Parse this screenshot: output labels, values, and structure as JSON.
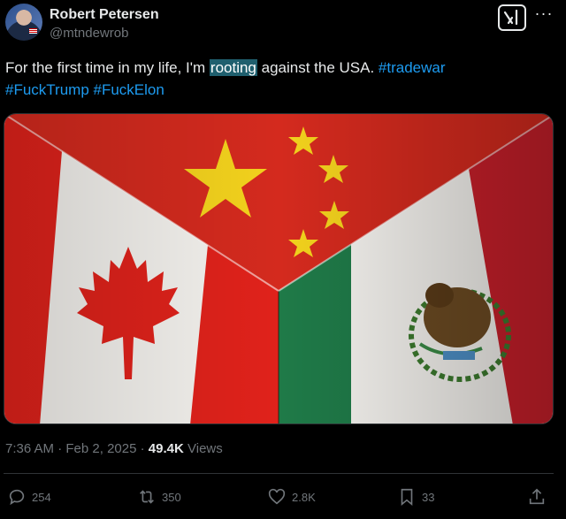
{
  "author": {
    "name": "Robert Petersen",
    "handle": "@mtndewrob"
  },
  "tweet": {
    "text_before": "For the first time in my life, I'm ",
    "highlighted_word": "rooting",
    "text_after": " against the USA. ",
    "hashtags": [
      "#tradewar",
      "#FuckTrump",
      "#FuckElon"
    ]
  },
  "media": {
    "description_icon": "flags-image",
    "colors": {
      "china_red": "#d42a1e",
      "china_star": "#f3d21d",
      "canada_red": "#e0221b",
      "mexico_green": "#1f7a48",
      "mexico_red": "#c81f2a",
      "white": "#f4f2ee"
    }
  },
  "meta": {
    "time": "7:36 AM",
    "date": "Feb 2, 2025",
    "views_count": "49.4K",
    "views_label": "Views"
  },
  "actions": {
    "replies": "254",
    "reposts": "350",
    "likes": "2.8K",
    "bookmarks": "33"
  },
  "colors": {
    "background": "#000000",
    "text": "#e7e9ea",
    "secondary": "#71767b",
    "link": "#1d9bf0",
    "highlight": "#1f5f6e"
  }
}
